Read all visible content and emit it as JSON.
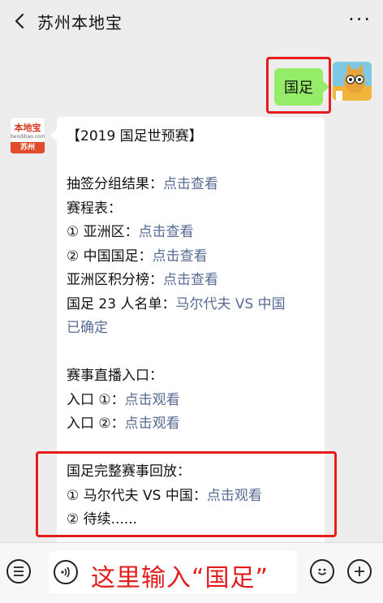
{
  "header": {
    "title": "苏州本地宝",
    "more": "···"
  },
  "outgoing": {
    "text": "国足"
  },
  "incoming_avatar": {
    "brand": "本地宝",
    "sub": "bendibao.com",
    "city": "苏州"
  },
  "message": {
    "title": "【2019 国足世预赛】",
    "draw_label": "抽签分组结果：",
    "draw_link": "点击查看",
    "schedule_label": "赛程表：",
    "asia_label": "① 亚洲区：",
    "asia_link": "点击查看",
    "china_label": "② 中国国足：",
    "china_link": "点击查看",
    "standings_label": "亚洲区积分榜：",
    "standings_link": "点击查看",
    "roster_label": "国足 23 人名单：",
    "roster_link_1": "马尔代夫 VS 中国",
    "roster_link_2": "已确定",
    "live_label": "赛事直播入口：",
    "entry1_label": "入口 ①：",
    "entry1_link": "点击观看",
    "entry2_label": "入口 ②：",
    "entry2_link": "点击观看",
    "replay_label": "国足完整赛事回放：",
    "replay1_label": "① 马尔代夫 VS 中国：",
    "replay1_link": "点击观看",
    "replay2_label": "② 待续......"
  },
  "input": {
    "annotation": "这里输入“国足”"
  },
  "colors": {
    "link": "#576b95",
    "outgoing_bubble": "#95ec69",
    "highlight": "#e41c1c"
  }
}
